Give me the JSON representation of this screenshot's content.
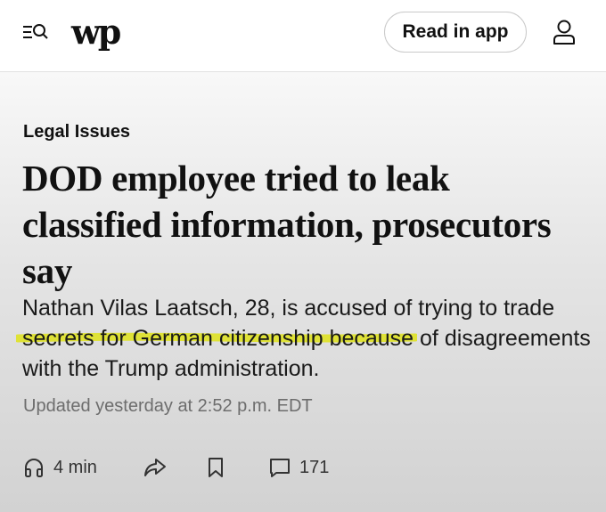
{
  "header": {
    "logo_text": "wp",
    "read_in_app_label": "Read in app",
    "icons": [
      "menu-search-icon",
      "account-icon"
    ]
  },
  "article": {
    "kicker": "Legal Issues",
    "headline": "DOD employee tried to leak classified information, prosecutors say",
    "dek": "Nathan Vilas Laatsch, 28, is accused of trying to trade secrets for German citizenship because of disagreements with the Trump administration.",
    "highlight_color": "#dfe31a",
    "updated": "Updated yesterday at 2:52 p.m. EDT"
  },
  "actions": {
    "listen_label": "4 min",
    "comments_count": "171",
    "icons": [
      "headphones-icon",
      "share-icon",
      "bookmark-icon",
      "comment-icon"
    ]
  }
}
